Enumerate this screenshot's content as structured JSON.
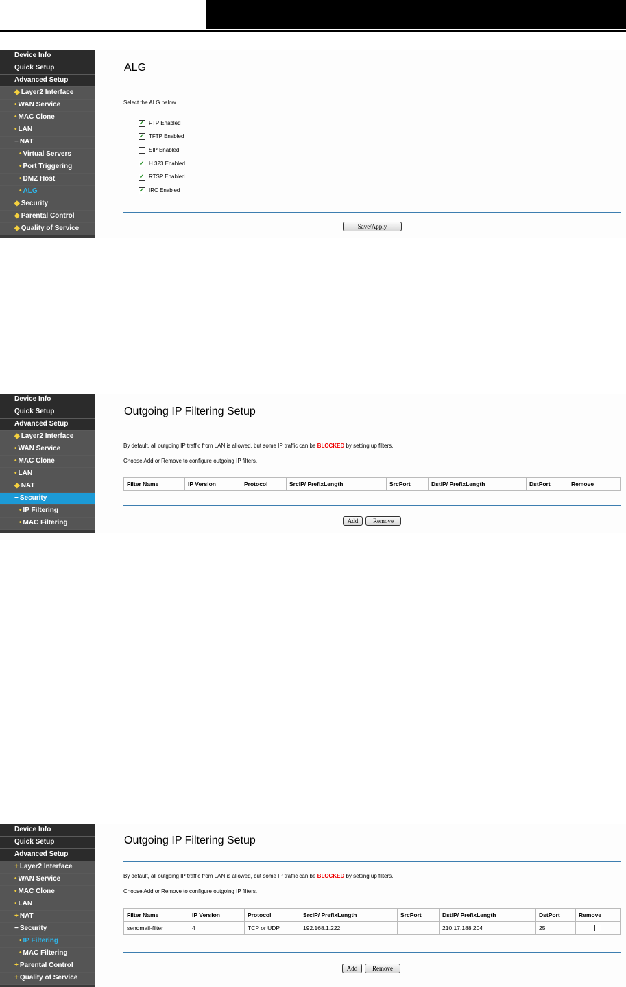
{
  "shot1": {
    "sidebar": [
      {
        "label": "Device Info"
      },
      {
        "label": "Quick Setup"
      },
      {
        "label": "Advanced Setup"
      },
      {
        "label": "Layer2 Interface"
      },
      {
        "label": "WAN Service"
      },
      {
        "label": "MAC Clone"
      },
      {
        "label": "LAN"
      },
      {
        "label": "NAT"
      },
      {
        "label": "Virtual Servers"
      },
      {
        "label": "Port Triggering"
      },
      {
        "label": "DMZ Host"
      },
      {
        "label": "ALG"
      },
      {
        "label": "Security"
      },
      {
        "label": "Parental Control"
      },
      {
        "label": "Quality of Service"
      }
    ],
    "title": "ALG",
    "instruction": "Select the ALG below.",
    "options": [
      {
        "label": "FTP Enabled",
        "checked": true
      },
      {
        "label": "TFTP Enabled",
        "checked": true
      },
      {
        "label": "SIP Enabled",
        "checked": false
      },
      {
        "label": "H.323 Enabled",
        "checked": true
      },
      {
        "label": "RTSP Enabled",
        "checked": true
      },
      {
        "label": "IRC Enabled",
        "checked": true
      }
    ],
    "save_label": "Save/Apply"
  },
  "shot2": {
    "sidebar": [
      {
        "label": "Device Info"
      },
      {
        "label": "Quick Setup"
      },
      {
        "label": "Advanced Setup"
      },
      {
        "label": "Layer2 Interface"
      },
      {
        "label": "WAN Service"
      },
      {
        "label": "MAC Clone"
      },
      {
        "label": "LAN"
      },
      {
        "label": "NAT"
      },
      {
        "label": "Security"
      },
      {
        "label": "IP Filtering"
      },
      {
        "label": "MAC Filtering"
      }
    ],
    "title": "Outgoing IP Filtering Setup",
    "intro_pre": "By default, all outgoing IP traffic from LAN is allowed, but some IP traffic can be ",
    "intro_blocked": "BLOCKED",
    "intro_post": " by setting up filters.",
    "instruction": "Choose Add or Remove to configure outgoing IP filters.",
    "columns": [
      "Filter Name",
      "IP Version",
      "Protocol",
      "SrcIP/ PrefixLength",
      "SrcPort",
      "DstIP/ PrefixLength",
      "DstPort",
      "Remove"
    ],
    "add_label": "Add",
    "remove_label": "Remove"
  },
  "shot3": {
    "sidebar": [
      {
        "label": "Device Info"
      },
      {
        "label": "Quick Setup"
      },
      {
        "label": "Advanced Setup"
      },
      {
        "label": "Layer2 Interface"
      },
      {
        "label": "WAN Service"
      },
      {
        "label": "MAC Clone"
      },
      {
        "label": "LAN"
      },
      {
        "label": "NAT"
      },
      {
        "label": "Security"
      },
      {
        "label": "IP Filtering"
      },
      {
        "label": "MAC Filtering"
      },
      {
        "label": "Parental Control"
      },
      {
        "label": "Quality of Service"
      }
    ],
    "title": "Outgoing IP Filtering Setup",
    "intro_pre": "By default, all outgoing IP traffic from LAN is allowed, but some IP traffic can be ",
    "intro_blocked": "BLOCKED",
    "intro_post": " by setting up filters.",
    "instruction": "Choose Add or Remove to configure outgoing IP filters.",
    "columns": [
      "Filter Name",
      "IP Version",
      "Protocol",
      "SrcIP/ PrefixLength",
      "SrcPort",
      "DstIP/ PrefixLength",
      "DstPort",
      "Remove"
    ],
    "rows": [
      {
        "name": "sendmail-filter",
        "ipver": "4",
        "protocol": "TCP or UDP",
        "src": "192.168.1.222",
        "srcport": "",
        "dst": "210.17.188.204",
        "dstport": "25",
        "remove": false
      }
    ],
    "add_label": "Add",
    "remove_label": "Remove"
  }
}
